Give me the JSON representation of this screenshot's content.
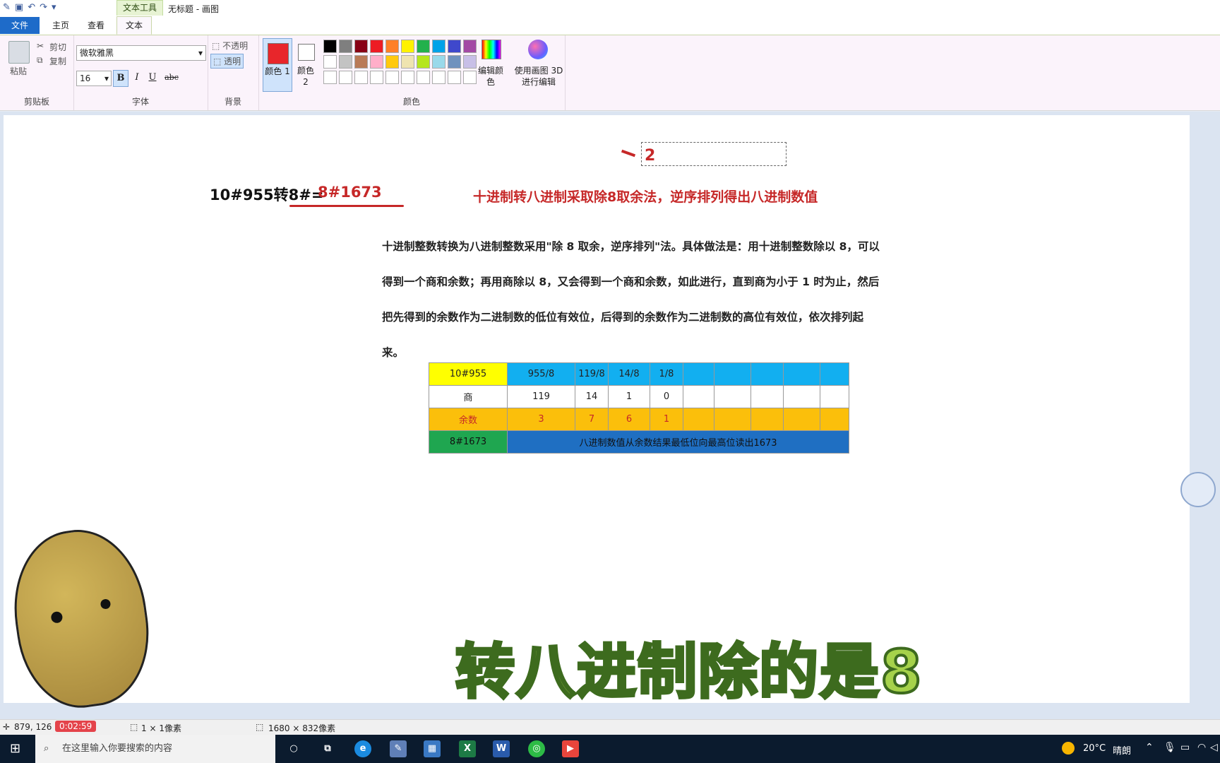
{
  "window": {
    "context_tab": "文本工具",
    "title": "无标题 - 画图"
  },
  "tabs": [
    {
      "label": "文件"
    },
    {
      "label": "主页"
    },
    {
      "label": "查看"
    },
    {
      "label": "文本"
    }
  ],
  "ribbon": {
    "clipboard": {
      "paste": "粘贴",
      "cut": "剪切",
      "copy": "复制",
      "group": "剪贴板"
    },
    "font": {
      "family": "微软雅黑",
      "size": "16",
      "bold": "B",
      "italic": "I",
      "underline": "U",
      "strike": "abc",
      "group": "字体"
    },
    "background": {
      "opaque": "不透明",
      "transparent": "透明",
      "group": "背景"
    },
    "colors": {
      "color1_label": "颜色 1",
      "color2_label": "颜色 2",
      "edit_label": "编辑颜色",
      "group": "颜色",
      "color1": "#e8262b",
      "color2": "#ffffff",
      "palette_row1": [
        "#000000",
        "#7f7f7f",
        "#880015",
        "#ed1c24",
        "#ff7f27",
        "#fff200",
        "#22b14c",
        "#00a2e8",
        "#3f48cc",
        "#a349a4"
      ],
      "palette_row2": [
        "#ffffff",
        "#c3c3c3",
        "#b97a57",
        "#ffaec9",
        "#ffc90e",
        "#efe4b0",
        "#b5e61d",
        "#99d9ea",
        "#7092be",
        "#c8bfe7"
      ]
    },
    "paint3d": {
      "label": "使用画图 3D 进行编辑"
    }
  },
  "canvas": {
    "text_box_value": "2",
    "equation_left": "10#955转8#=",
    "equation_answer": "8#1673",
    "red_heading": "十进制转八进制采取除8取余法，逆序排列得出八进制数值",
    "paragraph_lines": [
      "十进制整数转换为八进制整数采用\"除 8 取余，逆序排列\"法。具体做法是：用十进制整数除以 8，可以",
      "得到一个商和余数；再用商除以 8，又会得到一个商和余数，如此进行，直到商为小于 1 时为止，然后",
      "把先得到的余数作为二进制数的低位有效位，后得到的余数作为二进制数的高位有效位，依次排列起",
      "来。"
    ],
    "table": {
      "row1": [
        "10#955",
        "955/8",
        "119/8",
        "14/8",
        "1/8"
      ],
      "row2": [
        "商",
        "119",
        "14",
        "1",
        "0"
      ],
      "row3": [
        "余数",
        "3",
        "7",
        "6",
        "1"
      ],
      "row4": [
        "8#1673",
        "八进制数值从余数结果最低位向最高位读出1673"
      ]
    },
    "subtitle": "转八进制除的是8"
  },
  "status": {
    "cursor": "879, 126",
    "timer": "0:02:59",
    "selection": "1 × 1像素",
    "image_size": "1680 × 832像素"
  },
  "taskbar": {
    "search_placeholder": "在这里输入你要搜索的内容",
    "weather": "20°C",
    "weather_desc": "晴朗"
  }
}
